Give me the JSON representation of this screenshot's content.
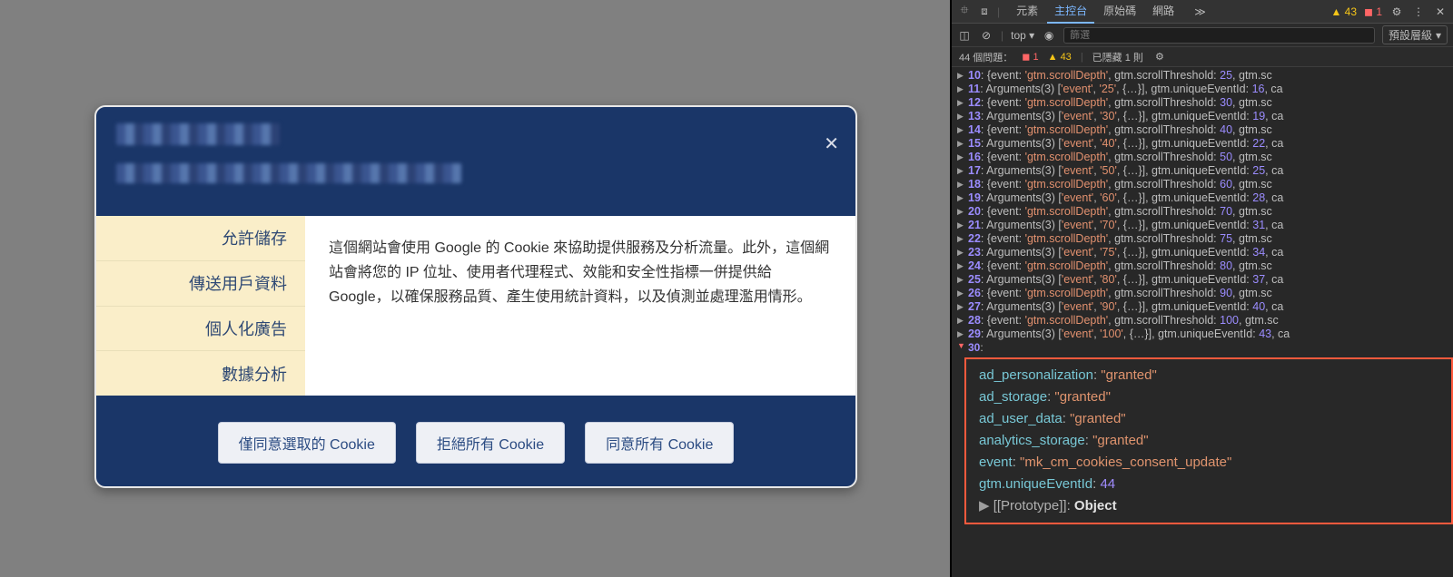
{
  "modal": {
    "tabs": [
      "允許儲存",
      "傳送用戶資料",
      "個人化廣告",
      "數據分析"
    ],
    "body": "這個網站會使用 Google 的 Cookie 來協助提供服務及分析流量。此外，這個網站會將您的 IP 位址、使用者代理程式、效能和安全性指標一併提供給 Google，以確保服務品質、產生使用統計資料，以及偵測並處理濫用情形。",
    "buttons": [
      "僅同意選取的 Cookie",
      "拒絕所有 Cookie",
      "同意所有 Cookie"
    ]
  },
  "devtools": {
    "tabs": [
      "元素",
      "主控台",
      "原始碼",
      "網路"
    ],
    "active_tab": 1,
    "more": "≫",
    "warnings": "43",
    "errors": "1",
    "top_label": "top",
    "filter_placeholder": "篩選",
    "level_label": "預設層級",
    "issues": {
      "label": "44 個問題：",
      "err": "1",
      "warn": "43",
      "hidden": "已隱藏 1 則"
    },
    "log_rows": [
      {
        "idx": "10",
        "kind": "evt",
        "thr": "25"
      },
      {
        "idx": "11",
        "kind": "arg",
        "pct": "25",
        "uid": "16"
      },
      {
        "idx": "12",
        "kind": "evt",
        "thr": "30"
      },
      {
        "idx": "13",
        "kind": "arg",
        "pct": "30",
        "uid": "19"
      },
      {
        "idx": "14",
        "kind": "evt",
        "thr": "40"
      },
      {
        "idx": "15",
        "kind": "arg",
        "pct": "40",
        "uid": "22"
      },
      {
        "idx": "16",
        "kind": "evt",
        "thr": "50"
      },
      {
        "idx": "17",
        "kind": "arg",
        "pct": "50",
        "uid": "25"
      },
      {
        "idx": "18",
        "kind": "evt",
        "thr": "60"
      },
      {
        "idx": "19",
        "kind": "arg",
        "pct": "60",
        "uid": "28"
      },
      {
        "idx": "20",
        "kind": "evt",
        "thr": "70"
      },
      {
        "idx": "21",
        "kind": "arg",
        "pct": "70",
        "uid": "31"
      },
      {
        "idx": "22",
        "kind": "evt",
        "thr": "75"
      },
      {
        "idx": "23",
        "kind": "arg",
        "pct": "75",
        "uid": "34"
      },
      {
        "idx": "24",
        "kind": "evt",
        "thr": "80"
      },
      {
        "idx": "25",
        "kind": "arg",
        "pct": "80",
        "uid": "37"
      },
      {
        "idx": "26",
        "kind": "evt",
        "thr": "90"
      },
      {
        "idx": "27",
        "kind": "arg",
        "pct": "90",
        "uid": "40"
      },
      {
        "idx": "28",
        "kind": "evt",
        "thr": "100"
      },
      {
        "idx": "29",
        "kind": "arg",
        "pct": "100",
        "uid": "43"
      }
    ],
    "expanded_idx": "30",
    "consent": {
      "ad_personalization": "granted",
      "ad_storage": "granted",
      "ad_user_data": "granted",
      "analytics_storage": "granted",
      "event": "mk_cm_cookies_consent_update",
      "gtm_uniqueEventId": "44",
      "proto": "Object"
    }
  }
}
